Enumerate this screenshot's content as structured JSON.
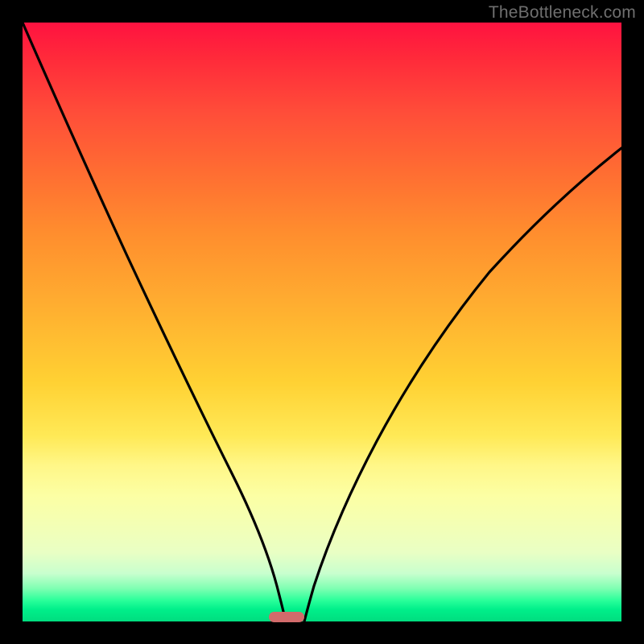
{
  "watermark": {
    "text": "TheBottleneck.com"
  },
  "colors": {
    "background": "#000000",
    "gradient_top": "#ff1240",
    "gradient_mid": "#ffd133",
    "gradient_bottom": "#00dd7f",
    "curve": "#000000",
    "marker": "#d26b6b",
    "watermark": "#6f6f6f"
  },
  "chart_data": {
    "type": "line",
    "title": "",
    "xlabel": "",
    "ylabel": "",
    "xlim": [
      0,
      100
    ],
    "ylim": [
      0,
      100
    ],
    "grid": false,
    "legend": false,
    "annotations": [
      {
        "kind": "marker",
        "shape": "pill",
        "x": 43.5,
        "y": 0,
        "width_pct": 5.5,
        "note": "ideal/no-bottleneck point"
      }
    ],
    "series": [
      {
        "name": "left-curve",
        "x": [
          0,
          5,
          10,
          15,
          20,
          25,
          30,
          35,
          40,
          41,
          42,
          43
        ],
        "values": [
          100,
          91,
          81,
          70,
          59,
          48,
          36,
          24,
          10,
          6,
          2,
          0
        ]
      },
      {
        "name": "right-curve",
        "x": [
          46,
          47,
          50,
          55,
          60,
          65,
          70,
          75,
          80,
          85,
          90,
          95,
          100
        ],
        "values": [
          0,
          5,
          15,
          28,
          38,
          47,
          54,
          60,
          66,
          71,
          75,
          79,
          82
        ]
      }
    ]
  }
}
